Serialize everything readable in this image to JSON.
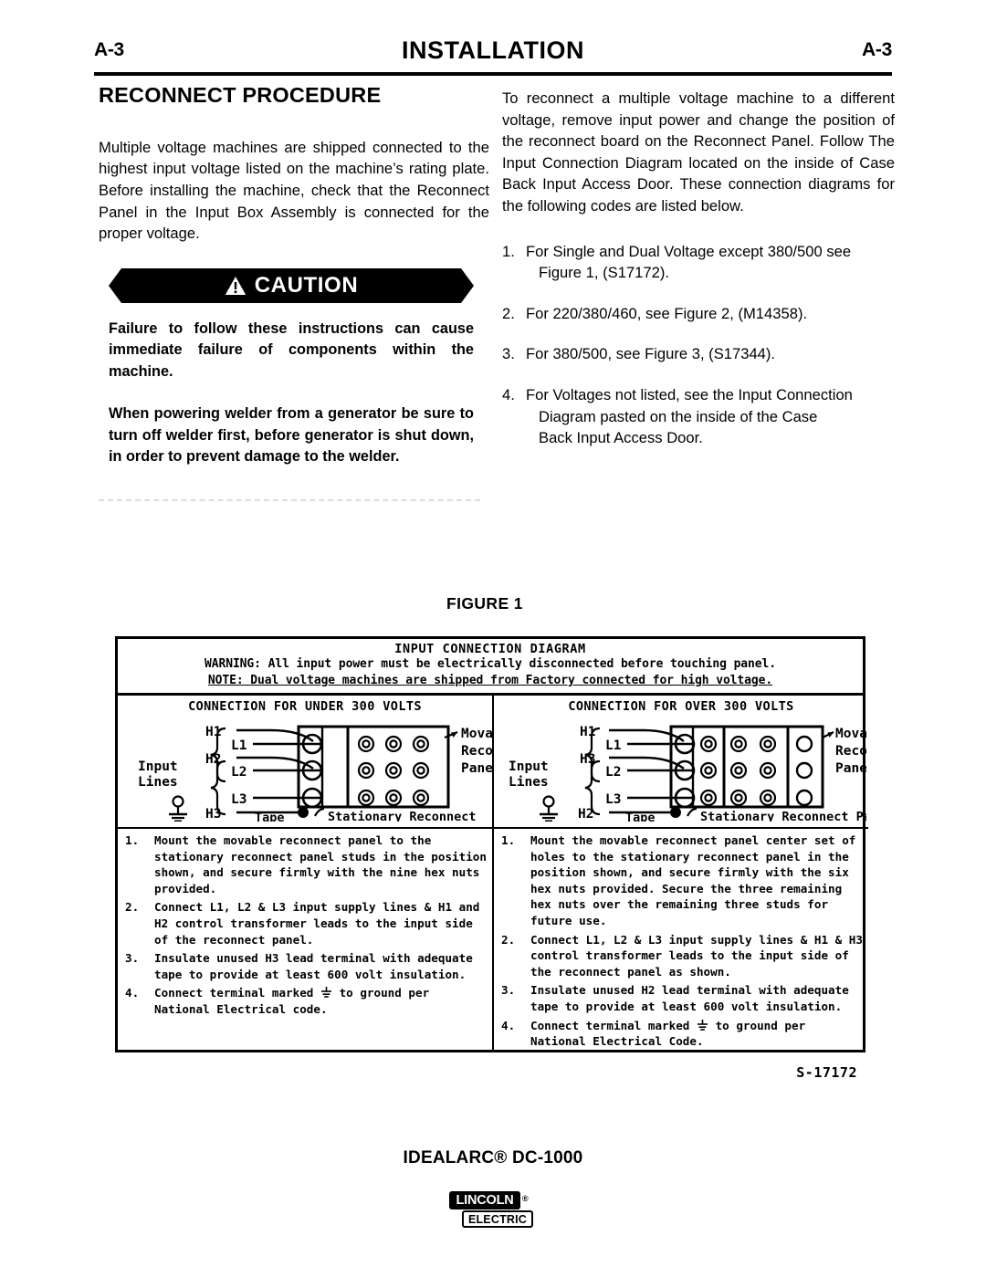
{
  "header": {
    "folio_left": "A-3",
    "section_title": "INSTALLATION",
    "folio_right": "A-3"
  },
  "left_column": {
    "heading": "RECONNECT PROCEDURE",
    "intro": "Multiple voltage machines are shipped connected to the highest input voltage listed on the machine’s rating plate. Before installing the machine, check that the Reconnect Panel in the Input Box Assembly is connected for the proper voltage.",
    "caution": {
      "label": "CAUTION",
      "icon": "warning-triangle-icon",
      "paragraph_1": "Failure to follow these instructions can cause immediate failure of components within the machine.",
      "paragraph_2": "When powering welder from a generator be sure to turn off welder first, before generator is shut down, in order to prevent damage to the welder."
    }
  },
  "right_column": {
    "intro": "To reconnect a multiple voltage machine to a different voltage, remove input power and change the position of the reconnect board on the Reconnect Panel. Follow The Input Connection Diagram located on the inside of Case Back Input Access Door.  These connection diagrams for the following codes are listed below.",
    "codes": [
      {
        "num": "1.",
        "line1": "For Single and Dual Voltage except 380/500 see",
        "line2": "Figure 1,  (S17172)."
      },
      {
        "num": "2.",
        "line1": "For 220/380/460, see Figure 2, (M14358).",
        "line2": ""
      },
      {
        "num": "3.",
        "line1": "For 380/500, see Figure 3, (S17344).",
        "line2": ""
      },
      {
        "num": "4.",
        "line1": "For Voltages not listed, see the Input Connection",
        "line2": "Diagram pasted on the inside of the Case",
        "line3": "Back Input Access Door."
      }
    ]
  },
  "figure": {
    "caption": "FIGURE 1",
    "code": "S-17172",
    "title": "INPUT CONNECTION DIAGRAM",
    "warning_label": "WARNING:",
    "warning_text": "All input power must be electrically disconnected before touching panel.",
    "note_label": "NOTE:",
    "note_text": "Dual voltage machines are shipped from Factory connected for high voltage.",
    "panels": [
      {
        "subtitle": "CONNECTION FOR UNDER 300 VOLTS",
        "labels": {
          "input_lines": "Input\nLines",
          "l1": "L1",
          "l2": "L2",
          "l3": "L3",
          "lead_top": "H1",
          "lead_mid": "H2",
          "lead_taped": "H3",
          "tape": "Tape",
          "movable": "Movable\nReconnect\nPanel",
          "stationary": "Stationary Reconnect\nPanel"
        },
        "steps": [
          {
            "num": "1.",
            "text": "Mount the movable reconnect panel to the stationary reconnect panel studs in the position shown, and secure firmly with the nine hex nuts provided."
          },
          {
            "num": "2.",
            "text": "Connect L1, L2 & L3 input supply lines & H1 and H2 control transformer leads to the input side of the reconnect panel."
          },
          {
            "num": "3.",
            "text": "Insulate unused H3 lead terminal with adequate tape to provide at least 600 volt insulation."
          },
          {
            "num": "4.",
            "text_before": "Connect terminal marked",
            "text_after": "to ground per National Electrical code."
          }
        ]
      },
      {
        "subtitle": "CONNECTION FOR OVER 300 VOLTS",
        "labels": {
          "input_lines": "Input\nLines",
          "l1": "L1",
          "l2": "L2",
          "l3": "L3",
          "lead_top": "H1",
          "lead_mid": "H3",
          "lead_taped": "H2",
          "tape": "Tape",
          "movable": "Movable\nReconnect\nPanel",
          "stationary": "Stationary Reconnect Panel"
        },
        "steps": [
          {
            "num": "1.",
            "text": "Mount the movable reconnect panel center set of holes to the stationary reconnect panel in the position shown, and secure firmly with the six hex nuts provided.  Secure the three remaining hex nuts over the remaining three studs for future use."
          },
          {
            "num": "2.",
            "text": "Connect L1, L2 & L3 input supply lines & H1 & H3 control transformer leads to the input side of the reconnect panel as shown."
          },
          {
            "num": "3.",
            "text": "Insulate unused H2 lead terminal with adequate tape to provide at least 600 volt insulation."
          },
          {
            "num": "4.",
            "text_before": "Connect terminal marked",
            "text_after": "to ground per National Electrical Code."
          }
        ]
      }
    ]
  },
  "footer": {
    "model": "IDEALARC® DC-1000",
    "logo_top": "LINCOLN",
    "logo_reg": "®",
    "logo_bottom": "ELECTRIC"
  }
}
